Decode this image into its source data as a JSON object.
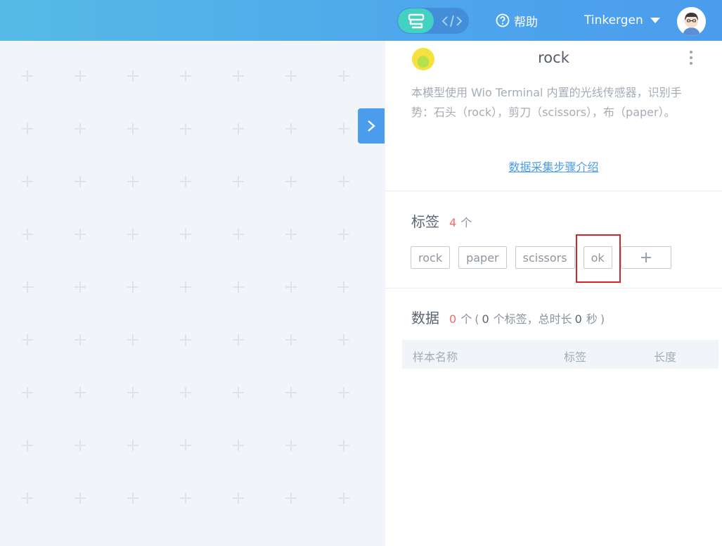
{
  "topbar": {
    "mode_blocks_icon": "blocks-icon",
    "mode_code_icon": "code-icon",
    "help_label": "帮助",
    "user_name": "Tinkergen"
  },
  "model": {
    "title": "rock",
    "description": "本模型使用 Wio Terminal 内置的光线传感器，识别手势：石头（rock），剪刀（scissors），布（paper）。",
    "intro_link": "数据采集步骤介绍"
  },
  "labels_section": {
    "title": "标签",
    "count": "4",
    "unit": "个",
    "tags": [
      "rock",
      "paper",
      "scissors",
      "ok"
    ],
    "add_icon": "plus-icon"
  },
  "data_section": {
    "title": "数据",
    "count": "0",
    "unit": "个",
    "paren_open": "(",
    "label_count": "0",
    "label_text": "个标签，总时长",
    "duration": "0",
    "duration_unit": "秒",
    "paren_close": ")"
  },
  "table": {
    "columns": [
      "样本名称",
      "标签",
      "长度"
    ]
  },
  "colors": {
    "accent": "#4a9cec",
    "blocks_mode": "#43d1c1",
    "count_red": "#f56c6c"
  }
}
